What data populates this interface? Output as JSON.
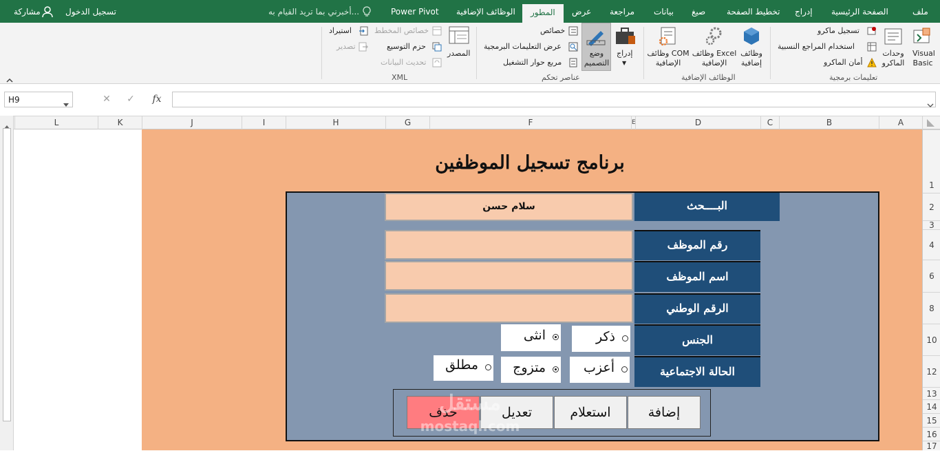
{
  "tabs": {
    "file": "ملف",
    "home": "الصفحة الرئيسية",
    "insert": "إدراج",
    "page_layout": "تخطيط الصفحة",
    "formulas": "صيغ",
    "data": "بيانات",
    "review": "مراجعة",
    "view": "عرض",
    "developer": "المطور",
    "addins": "الوظائف الإضافية",
    "power_pivot": "Power Pivot",
    "tell_me": "أخبرني بما تريد القيام به...",
    "sign_in": "تسجيل الدخول",
    "share": "مشاركة"
  },
  "ribbon": {
    "code": {
      "group": "تعليمات برمجية",
      "visual_basic": "Visual Basic",
      "macros": "وحدات الماكرو",
      "record_macro": "تسجيل ماكرو",
      "relative_refs": "استخدام المراجع النسبية",
      "macro_security": "أمان الماكرو"
    },
    "addins": {
      "group": "الوظائف الإضافية",
      "addins": "وظائف إضافية",
      "excel_addins": "وظائف Excel الإضافية",
      "com_addins": "وظائف COM الإضافية"
    },
    "controls": {
      "group": "عناصر تحكم",
      "insert": "إدراج",
      "design_mode": "وضع التصميم",
      "properties": "خصائص",
      "view_code": "عرض التعليمات البرمجية",
      "run_dialog": "مربع حوار التشغيل"
    },
    "xml": {
      "group": "XML",
      "source": "المصدر",
      "map_properties": "خصائص المخطط",
      "expansion_packs": "حزم التوسيع",
      "refresh_data": "تحديث البيانات",
      "import": "استيراد",
      "export": "تصدير"
    }
  },
  "formula_bar": {
    "name_box": "H9",
    "formula": ""
  },
  "columns": [
    "A",
    "B",
    "C",
    "D",
    "E",
    "F",
    "G",
    "H",
    "I",
    "J",
    "K",
    "L"
  ],
  "rows": [
    "1",
    "2",
    "3",
    "4",
    "6",
    "8",
    "10",
    "12",
    "13",
    "14",
    "15",
    "16",
    "17"
  ],
  "form": {
    "title": "برنامج تسجيل الموظفين",
    "search_label": "البــــحث",
    "search_value": "سلام حسن",
    "emp_id_label": "رقم الموظف",
    "emp_id_value": "",
    "emp_name_label": "اسم الموظف",
    "emp_name_value": "",
    "national_id_label": "الرقم الوطني",
    "national_id_value": "",
    "gender_label": "الجنس",
    "gender_male": "ذكر",
    "gender_female": "انثى",
    "marital_label": "الحالة الاجتماعية",
    "marital_single": "أعزب",
    "marital_married": "متزوج",
    "marital_divorced": "مطلق",
    "btn_add": "إضافة",
    "btn_query": "استعلام",
    "btn_edit": "تعديل",
    "btn_delete": "حذف"
  },
  "watermark": {
    "arabic": "مستقل",
    "latin": "mostaql.com"
  },
  "colors": {
    "excel_green": "#217346",
    "sheet_orange": "#f4b183",
    "panel_bluegray": "#8497b0",
    "label_navy": "#1f4e79",
    "field_peach": "#f8cbad",
    "delete_red": "#ff7c80"
  },
  "icons": [
    "user-icon",
    "lightbulb-icon",
    "visual-basic-icon",
    "macros-icon",
    "record-macro-icon",
    "relative-refs-icon",
    "warning-icon",
    "addins-icon",
    "excel-addins-icon",
    "com-addins-icon",
    "toolbox-icon",
    "design-mode-icon",
    "properties-icon",
    "view-code-icon",
    "run-dialog-icon",
    "source-icon",
    "map-properties-icon",
    "expansion-packs-icon",
    "refresh-data-icon",
    "import-icon",
    "export-icon",
    "collapse-ribbon-icon",
    "cancel-icon",
    "enter-icon",
    "function-icon",
    "dropdown-icon"
  ],
  "radio_state": {
    "gender": "female",
    "marital": "married"
  }
}
